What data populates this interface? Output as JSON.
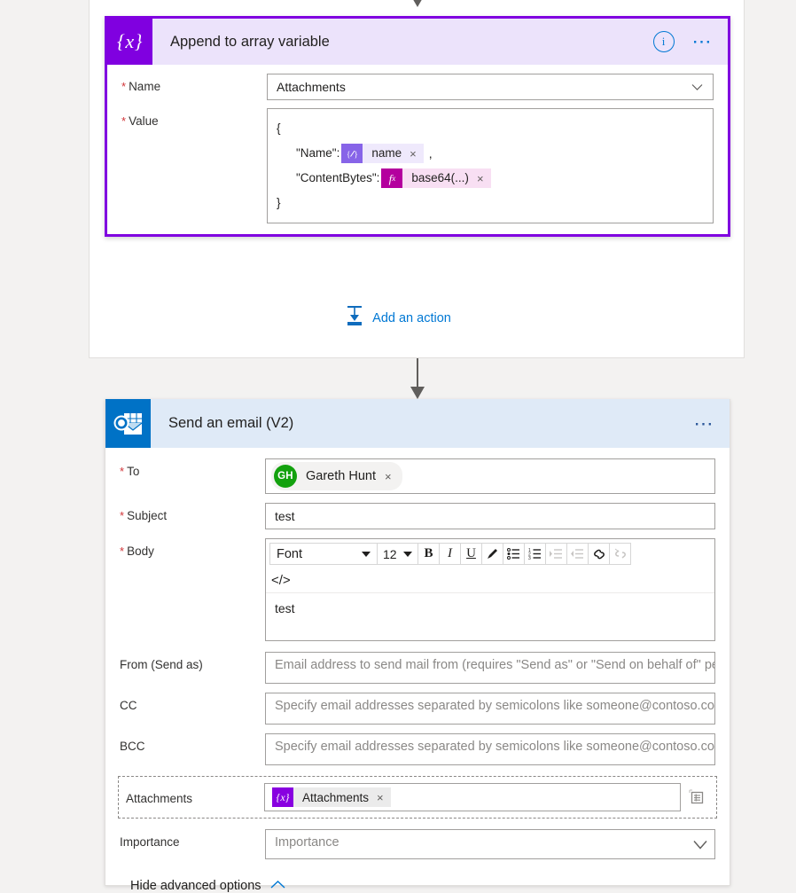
{
  "flow": {
    "append_card": {
      "icon": "variable-braces-icon",
      "title": "Append to array variable",
      "info_icon": "info-icon",
      "menu_icon": "ellipsis-icon",
      "fields": {
        "name": {
          "label": "Name",
          "required": true,
          "value": "Attachments",
          "chevron": "chevron-down-icon"
        },
        "value": {
          "label": "Value",
          "required": true,
          "json": {
            "open_brace": "{",
            "close_brace": "}",
            "name_key": "\"Name\":",
            "name_token": {
              "icon": "dynamic-content-icon",
              "text": "name",
              "remove": "×"
            },
            "comma": ",",
            "content_key": "\"ContentBytes\":",
            "content_token": {
              "icon": "fx-expression-icon",
              "text": "base64(...)",
              "remove": "×"
            }
          }
        }
      }
    },
    "add_action": {
      "icon": "insert-action-icon",
      "label": "Add an action"
    },
    "email_card": {
      "icon": "outlook-icon",
      "title": "Send an email (V2)",
      "menu_icon": "ellipsis-icon",
      "fields": {
        "to": {
          "label": "To",
          "required": true,
          "recipient": {
            "initials": "GH",
            "name": "Gareth Hunt",
            "remove": "×"
          }
        },
        "subject": {
          "label": "Subject",
          "required": true,
          "value": "test"
        },
        "body": {
          "label": "Body",
          "required": true,
          "toolbar": {
            "font": "Font",
            "size": "12",
            "bold": "B",
            "italic": "I",
            "underline": "U",
            "highlight": "pen-icon",
            "bullet_list": "bulleted-list-icon",
            "numbered_list": "numbered-list-icon",
            "indent": "indent-icon",
            "outdent": "outdent-icon",
            "link": "link-icon",
            "unlink": "unlink-icon",
            "code_view": "</>"
          },
          "content": "test"
        },
        "from": {
          "label": "From (Send as)",
          "placeholder": "Email address to send mail from (requires \"Send as\" or \"Send on behalf of\" permissions)"
        },
        "cc": {
          "label": "CC",
          "placeholder": "Specify email addresses separated by semicolons like someone@contoso.com"
        },
        "bcc": {
          "label": "BCC",
          "placeholder": "Specify email addresses separated by semicolons like someone@contoso.com"
        },
        "attachments": {
          "label": "Attachments",
          "token": {
            "icon": "variable-braces-icon",
            "text": "Attachments",
            "remove": "×"
          },
          "array_toggle_icon": "switch-to-array-icon"
        },
        "importance": {
          "label": "Importance",
          "placeholder": "Importance",
          "chevron": "chevron-down-icon"
        }
      },
      "advanced_options": {
        "label": "Hide advanced options",
        "icon": "chevron-up-icon"
      }
    }
  },
  "colors": {
    "variable_purple": "#8000E0",
    "outlook_blue": "#0072C6",
    "accent_blue": "#0078d4",
    "avatar_green": "#13A10E",
    "fx_magenta": "#b4009e",
    "dynamic_purple": "#8764e8",
    "required_red": "#d13438"
  }
}
